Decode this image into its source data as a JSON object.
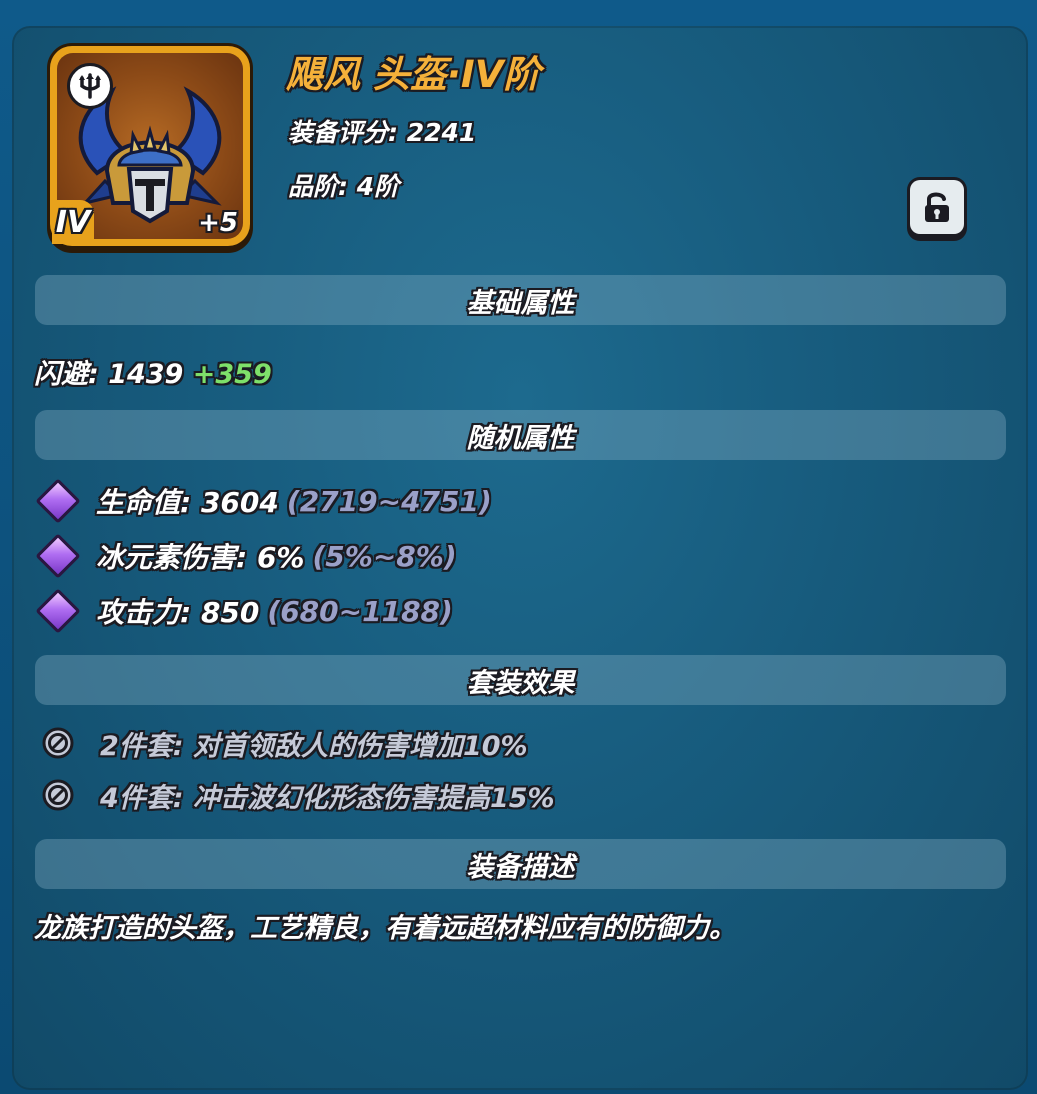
{
  "item": {
    "title": "飓风 头盔·IV阶",
    "score": "装备评分: 2241",
    "grade": "品阶: 4阶",
    "tier_badge": "IV",
    "enhance": "+5",
    "set_icon": "trident-icon",
    "lock_icon": "unlock-icon"
  },
  "sections": {
    "base": "基础属性",
    "random": "随机属性",
    "set": "套装效果",
    "desc": "装备描述"
  },
  "base_stat": {
    "label": "闪避: 1439",
    "bonus": "+359"
  },
  "random_stats": [
    {
      "label": "生命值: 3604",
      "range": "(2719~4751)"
    },
    {
      "label": "冰元素伤害: 6%",
      "range": "(5%~8%)"
    },
    {
      "label": "攻击力: 850",
      "range": "(680~1188)"
    }
  ],
  "set_effects": [
    {
      "text": "2件套: 对首领敌人的伤害增加10%"
    },
    {
      "text": "4件套: 冲击波幻化形态伤害提高15%"
    }
  ],
  "description": "龙族打造的头盔，工艺精良，有着远超材料应有的防御力。",
  "colors": {
    "title": "#f5b13a",
    "bonus": "#7ee06a",
    "range": "#9aa0c8",
    "frame": "#e8a21c"
  }
}
